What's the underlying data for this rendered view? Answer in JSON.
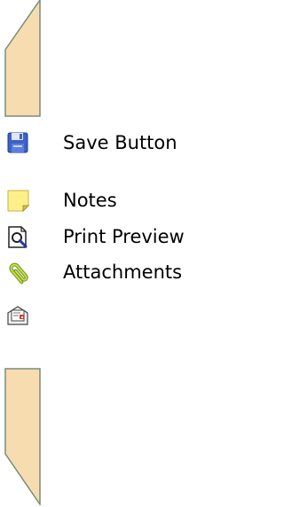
{
  "items": [
    {
      "label": "Save Button",
      "icon": "save-icon"
    },
    {
      "label": "Notes",
      "icon": "note-icon"
    },
    {
      "label": "Print Preview",
      "icon": "print-preview-icon"
    },
    {
      "label": "Attachments",
      "icon": "paperclip-icon"
    },
    {
      "label": "",
      "icon": "send-document-icon"
    }
  ],
  "colors": {
    "tab_fill": "#f7dcb0",
    "tab_stroke": "#7a8c78",
    "save_blue": "#3b62c9",
    "note_yellow": "#fdf08a",
    "clip_green": "#b2d43a"
  }
}
